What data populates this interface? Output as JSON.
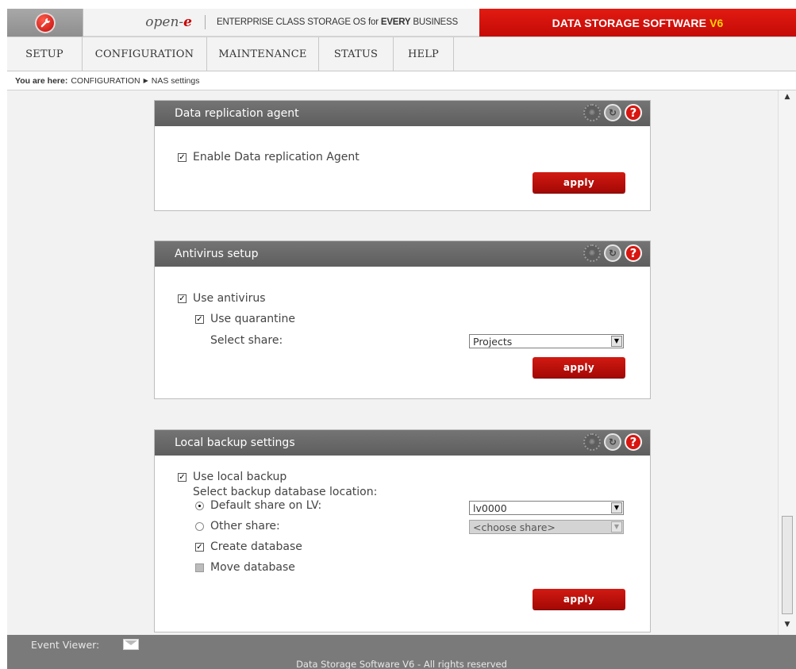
{
  "header": {
    "logo_icon": "wrench-icon",
    "brand_main": "open-",
    "brand_e": "e",
    "tagline_pre": "ENTERPRISE CLASS STORAGE OS for ",
    "tagline_bold": "EVERY",
    "tagline_post": " BUSINESS",
    "product": "DATA STORAGE SOFTWARE",
    "version": "V6",
    "brand_red": "#d0120b",
    "version_color": "#ffd400"
  },
  "nav": {
    "items": [
      {
        "label": "SETUP"
      },
      {
        "label": "CONFIGURATION"
      },
      {
        "label": "MAINTENANCE"
      },
      {
        "label": "STATUS"
      },
      {
        "label": "HELP"
      }
    ]
  },
  "breadcrumb": {
    "prefix": "You are here:",
    "items": [
      "CONFIGURATION",
      "NAS settings"
    ]
  },
  "panels": {
    "replication": {
      "title": "Data replication agent",
      "enable_label": "Enable Data replication Agent",
      "enable_checked": true,
      "apply": "apply"
    },
    "antivirus": {
      "title": "Antivirus setup",
      "use_antivirus": "Use antivirus",
      "use_antivirus_checked": true,
      "use_quarantine": "Use quarantine",
      "use_quarantine_checked": true,
      "select_share_label": "Select share:",
      "select_share_value": "Projects",
      "apply": "apply"
    },
    "backup": {
      "title": "Local backup settings",
      "use_local_backup": "Use local backup",
      "use_local_backup_checked": true,
      "location_label": "Select backup database location:",
      "default_share": "Default share on LV:",
      "default_share_selected": true,
      "default_share_value": "lv0000",
      "other_share": "Other share:",
      "other_share_selected": false,
      "other_share_value": "<choose share>",
      "create_db": "Create database",
      "create_db_checked": true,
      "move_db": "Move database",
      "move_db_checked": false,
      "apply": "apply"
    }
  },
  "footer": {
    "event_viewer": "Event Viewer:",
    "envelope_icon": "envelope-icon",
    "copyright": "Data Storage Software V6 - All rights reserved"
  }
}
